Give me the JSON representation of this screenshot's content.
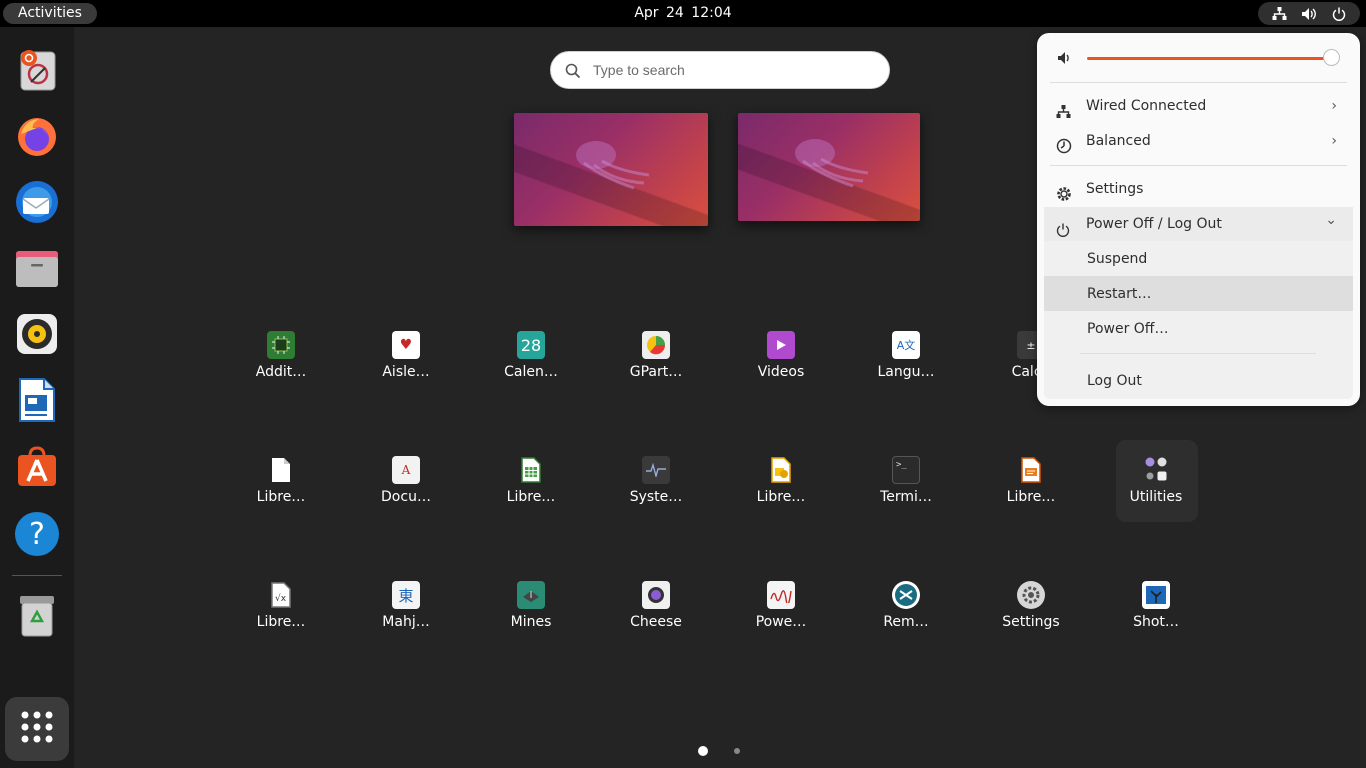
{
  "topbar": {
    "activities_label": "Activities",
    "date": "Apr 24",
    "time": "12:04"
  },
  "dock": {
    "apps": [
      {
        "name": "Ubuntu Installer",
        "icon": "installer-icon"
      },
      {
        "name": "Firefox",
        "icon": "firefox-icon"
      },
      {
        "name": "Thunderbird",
        "icon": "thunderbird-icon"
      },
      {
        "name": "Files",
        "icon": "files-icon"
      },
      {
        "name": "Rhythmbox",
        "icon": "rhythmbox-icon"
      },
      {
        "name": "LibreOffice Writer",
        "icon": "writer-icon"
      },
      {
        "name": "Ubuntu Software",
        "icon": "software-icon"
      },
      {
        "name": "Help",
        "icon": "help-icon"
      },
      {
        "name": "Trash",
        "icon": "trash-icon"
      }
    ],
    "help_glyph": "?",
    "show_apps_icon": "grid-icon"
  },
  "search": {
    "placeholder": "Type to search"
  },
  "app_grid": {
    "rows": [
      [
        "Addit…",
        "Aisle…",
        "Calen…",
        "GPart…",
        "Videos",
        "Langu…",
        "Calcu"
      ],
      [
        "Libre…",
        "Docu…",
        "Libre…",
        "Syste…",
        "Libre…",
        "Termi…",
        "Libre…",
        "Utilities"
      ],
      [
        "Libre…",
        "Mahj…",
        "Mines",
        "Cheese",
        "Powe…",
        "Rem…",
        "Settings",
        "Shot…"
      ]
    ],
    "calendar_day": "28"
  },
  "quick_settings": {
    "volume_level": 0.96,
    "wired": "Wired Connected",
    "power_mode": "Balanced",
    "settings": "Settings",
    "power_off_log_out": "Power Off / Log Out",
    "suspend": "Suspend",
    "restart": "Restart…",
    "power_off": "Power Off…",
    "log_out": "Log Out",
    "chevron_right": "›",
    "chevron_down": "⌄"
  },
  "pager": {
    "pages": 2,
    "current": 1
  },
  "colors": {
    "accent": "#e95420",
    "panel_bg": "#fafafa",
    "desktop_bg": "#242424"
  }
}
